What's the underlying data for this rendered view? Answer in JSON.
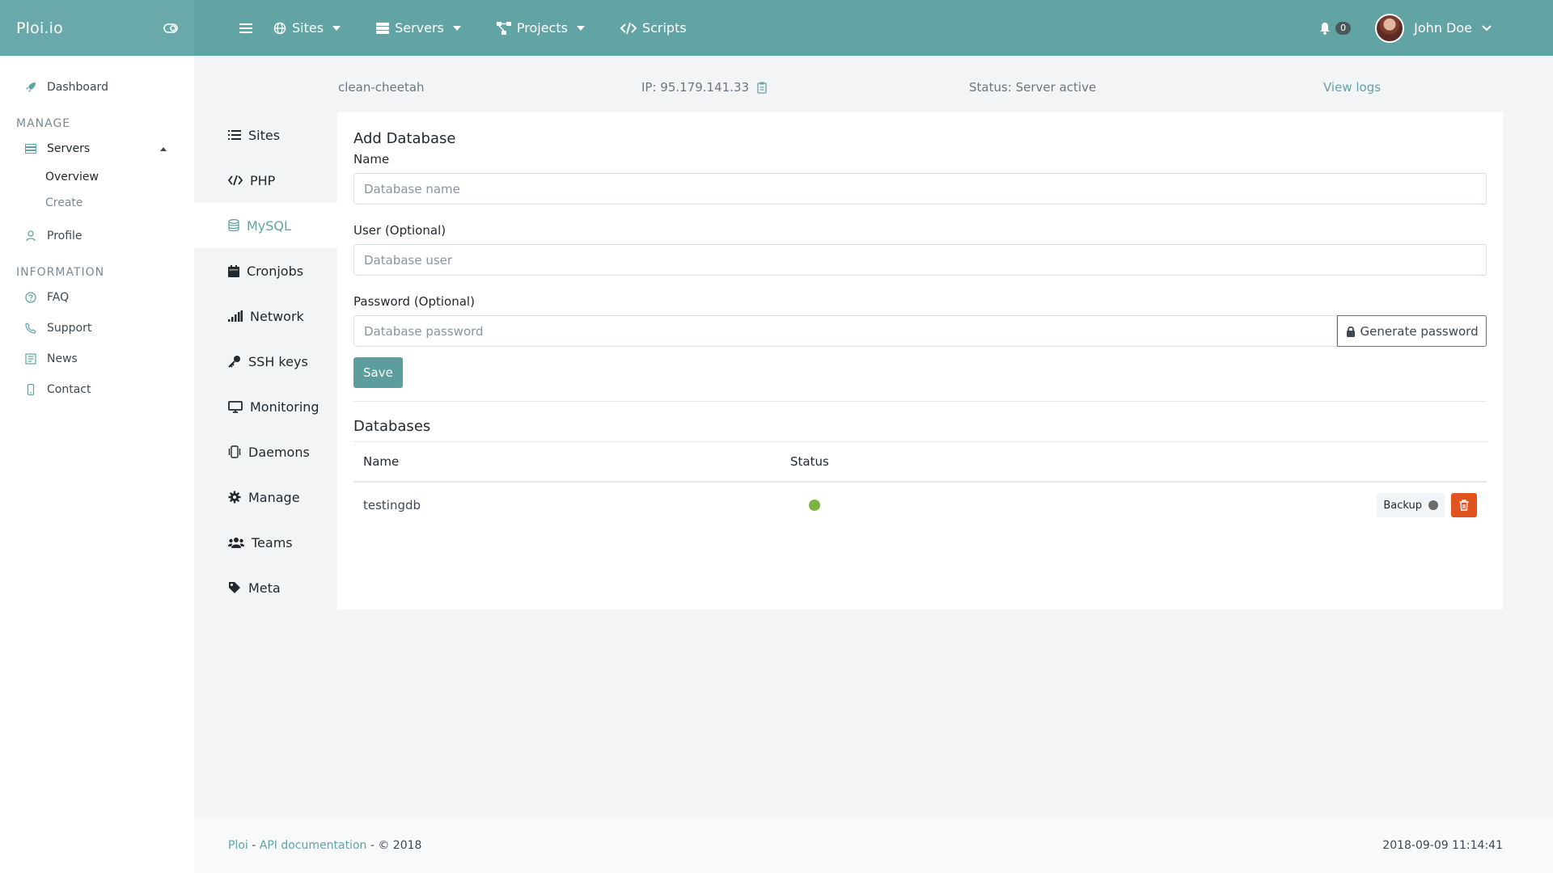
{
  "brand": "Ploi.io",
  "topnav": {
    "items": [
      {
        "label": "Sites",
        "icon": "globe-icon"
      },
      {
        "label": "Servers",
        "icon": "server-icon"
      },
      {
        "label": "Projects",
        "icon": "project-icon"
      },
      {
        "label": "Scripts",
        "icon": "code-icon"
      }
    ],
    "notifications": "0",
    "user": "John Doe"
  },
  "sidebar": {
    "dashboard": "Dashboard",
    "manage_heading": "MANAGE",
    "servers": "Servers",
    "overview": "Overview",
    "create": "Create",
    "profile": "Profile",
    "information_heading": "INFORMATION",
    "faq": "FAQ",
    "support": "Support",
    "news": "News",
    "contact": "Contact"
  },
  "server": {
    "name": "clean-cheetah",
    "ip": "IP: 95.179.141.33",
    "status": "Status: Server active",
    "view_logs": "View logs"
  },
  "subnav": {
    "items": [
      "Sites",
      "PHP",
      "MySQL",
      "Cronjobs",
      "Network",
      "SSH keys",
      "Monitoring",
      "Daemons",
      "Manage",
      "Teams",
      "Meta"
    ],
    "active": "MySQL"
  },
  "form": {
    "title": "Add Database",
    "name_label": "Name",
    "name_placeholder": "Database name",
    "user_label": "User (Optional)",
    "user_placeholder": "Database user",
    "password_label": "Password (Optional)",
    "password_placeholder": "Database password",
    "generate_label": "Generate password",
    "save_label": "Save"
  },
  "databases": {
    "title": "Databases",
    "columns": [
      "Name",
      "Status"
    ],
    "rows": [
      {
        "name": "testingdb",
        "status_color": "#7cb342",
        "backup_label": "Backup"
      }
    ]
  },
  "footer": {
    "ploi": "Ploi",
    "sep1": " - ",
    "api": "API documentation",
    "copyright": " - © 2018",
    "datetime": "2018-09-09 11:14:41"
  },
  "colors": {
    "accent": "#62a3a3",
    "danger": "#e0541f",
    "success": "#7cb342"
  }
}
